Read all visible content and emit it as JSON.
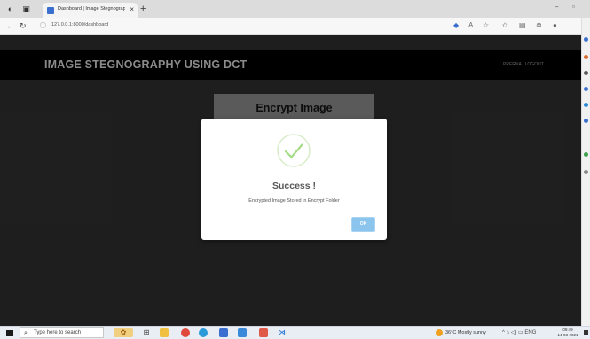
{
  "browser": {
    "tab_title": "Dashboard | Image Stegnograph:",
    "tab_close": "×",
    "new_tab": "+",
    "url": "127.0.0.1:8000/dashboard",
    "window_controls": [
      "–",
      "▫"
    ]
  },
  "header": {
    "brand": "IMAGE STEGNOGRAPHY USING DCT",
    "user_links": "PRERNA | LOGOUT"
  },
  "card": {
    "title": "Encrypt Image"
  },
  "modal": {
    "title": "Success !",
    "message": "Encrypted Image Stored in Encrypt Folder",
    "ok_label": "OK"
  },
  "taskbar": {
    "search_placeholder": "Type here to search",
    "weather": "36°C  Mostly sunny",
    "tray": "^  ⌂  ◁)  ▭  ENG",
    "time": "09:49",
    "date": "14-03-2021"
  },
  "colors": {
    "page_bg": "#2f2f2f",
    "header_bg": "#000000",
    "card_bg": "#8a8a8a",
    "success_green": "#a5dc86",
    "ok_button": "#8bc4ec"
  }
}
